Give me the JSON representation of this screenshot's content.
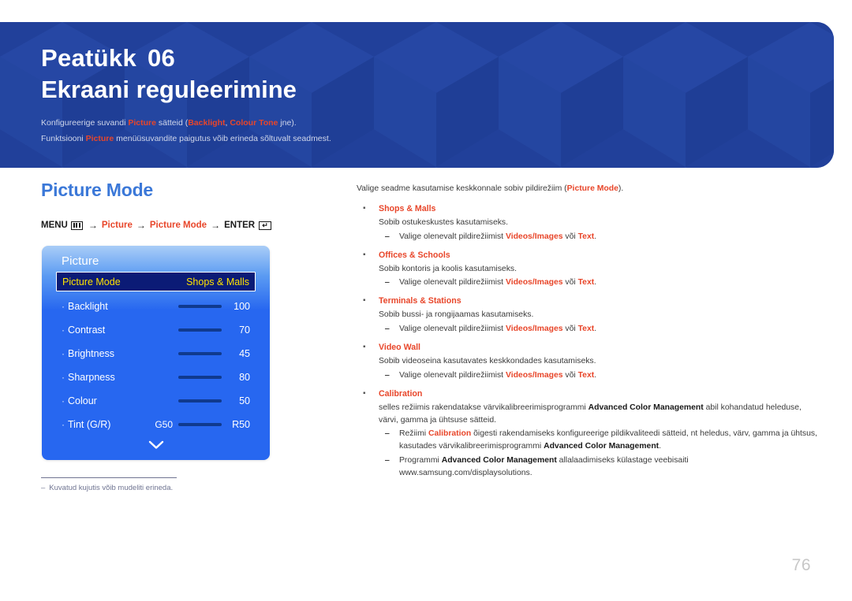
{
  "banner": {
    "chapter_label": "Peatükk",
    "chapter_number": "06",
    "title": "Ekraani reguleerimine",
    "sub_line1_pre": "Konfigureerige suvandi ",
    "sub_line1_hl1": "Picture",
    "sub_line1_mid": " sätteid (",
    "sub_line1_hl2": "Backlight",
    "sub_line1_comma": ", ",
    "sub_line1_hl3": "Colour Tone",
    "sub_line1_post": " jne).",
    "sub_line2_pre": "Funktsiooni ",
    "sub_line2_hl1": "Picture",
    "sub_line2_post": " menüüsuvandite paigutus võib erineda sõltuvalt seadmest.",
    "bg_color": "#21409a"
  },
  "left": {
    "section_heading": "Picture Mode",
    "menu_path": {
      "menu_label": "MENU",
      "menu_icon": "menu-grid-icon",
      "arrow": "→",
      "step1": "Picture",
      "step2": "Picture Mode",
      "enter_label": "ENTER",
      "enter_icon": "enter-return-icon",
      "enter_glyph": "↵"
    },
    "footnote": {
      "dash": "‒",
      "text": "Kuvatud kujutis võib mudeliti erineda."
    }
  },
  "osd": {
    "title": "Picture",
    "selected_row": {
      "label": "Picture Mode",
      "value": "Shops & Malls"
    },
    "rows": [
      {
        "dot": "·",
        "label": "Backlight",
        "left_value": "",
        "value": "100"
      },
      {
        "dot": "·",
        "label": "Contrast",
        "left_value": "",
        "value": "70"
      },
      {
        "dot": "·",
        "label": "Brightness",
        "left_value": "",
        "value": "45"
      },
      {
        "dot": "·",
        "label": "Sharpness",
        "left_value": "",
        "value": "80"
      },
      {
        "dot": "·",
        "label": "Colour",
        "left_value": "",
        "value": "50"
      },
      {
        "dot": "·",
        "label": "Tint (G/R)",
        "left_value": "G50",
        "value": "R50"
      }
    ],
    "scroll_down_icon": "chevron-down-icon",
    "colors": {
      "panel_blue": "#2767f0",
      "selected_navy": "#0b1b76",
      "selected_text": "#ffe300",
      "slider_bar": "#103a8e"
    }
  },
  "right": {
    "intro": {
      "pre": "Valige seadme kasutamise keskkonnale sobiv pildirežiim (",
      "hl": "Picture Mode",
      "post": ")."
    },
    "bullet_marker": "▪",
    "dash_marker": "‒",
    "sub_line_pre": "Valige olenevalt pildirežiimist ",
    "sub_line_hl1": "Videos/Images",
    "sub_line_mid": " või ",
    "sub_line_hl2": "Text",
    "sub_line_post": ".",
    "items": [
      {
        "title": "Shops & Malls",
        "desc": "Sobib ostukeskustes kasutamiseks."
      },
      {
        "title": "Offices & Schools",
        "desc": "Sobib kontoris ja koolis kasutamiseks."
      },
      {
        "title": "Terminals & Stations",
        "desc": "Sobib bussi- ja rongijaamas kasutamiseks."
      },
      {
        "title": "Video Wall",
        "desc": "Sobib videoseina kasutavates keskkondades kasutamiseks."
      }
    ],
    "calibration": {
      "title": "Calibration",
      "desc_pre": "selles režiimis rakendatakse värvikalibreerimisprogrammi ",
      "desc_b": "Advanced Color Management",
      "desc_post": " abil kohandatud heleduse, värvi, gamma ja ühtsuse sätteid.",
      "note1_pre": "Režiimi ",
      "note1_hl": "Calibration",
      "note1_mid": " õigesti rakendamiseks konfigureerige pildikvaliteedi sätteid, nt heledus, värv, gamma ja ühtsus, kasutades värvikalibreerimisprogrammi ",
      "note1_b": "Advanced Color Management",
      "note1_post": ".",
      "note2_pre": "Programmi ",
      "note2_b": "Advanced Color Management",
      "note2_post": " allalaadimiseks külastage veebisaiti www.samsung.com/displaysolutions."
    }
  },
  "page_number": "76"
}
